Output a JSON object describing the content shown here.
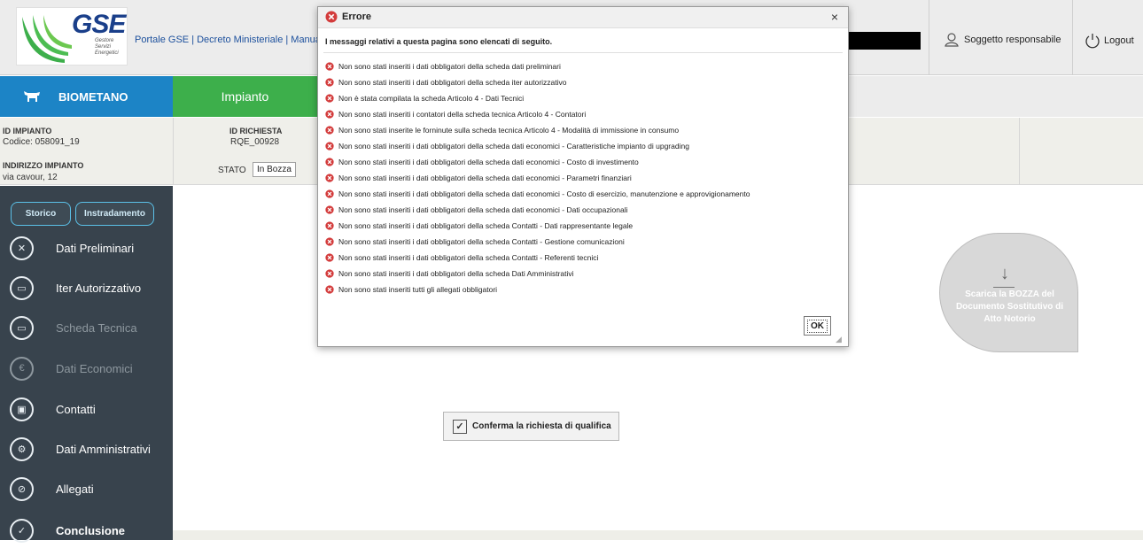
{
  "header": {
    "logo_text": "GSE",
    "logo_subtitle": "Gestore Servizi Energetici",
    "links": "Portale GSE | Decreto Ministeriale | Manuale",
    "user_label": "Soggetto responsabile",
    "logout_label": "Logout"
  },
  "nav": {
    "biometano": "BIOMETANO",
    "impianto": "Impianto"
  },
  "info": {
    "id_impianto_label": "ID IMPIANTO",
    "codice": "Codice: 058091_19",
    "indirizzo_label": "INDIRIZZO IMPIANTO",
    "indirizzo": "via cavour, 12",
    "id_richiesta_label": "ID RICHIESTA",
    "id_richiesta": "RQE_00928",
    "stato_label": "STATO",
    "stato": "In Bozza"
  },
  "sidebar": {
    "storico": "Storico",
    "instradamento": "Instradamento",
    "items": [
      {
        "label": "Dati Preliminari",
        "icon": "x-icon"
      },
      {
        "label": "Iter Autorizzativo",
        "icon": "calendar-icon"
      },
      {
        "label": "Scheda Tecnica",
        "icon": "wallet-icon"
      },
      {
        "label": "Dati Economici",
        "icon": "euro-icon"
      },
      {
        "label": "Contatti",
        "icon": "contacts-icon"
      },
      {
        "label": "Dati Amministrativi",
        "icon": "gear-icon"
      },
      {
        "label": "Allegati",
        "icon": "paperclip-icon"
      },
      {
        "label": "Conclusione",
        "icon": "check-icon"
      }
    ]
  },
  "main": {
    "confirm_button": "Conferma la richiesta di qualifica",
    "download_text": "Scarica la BOZZA del Documento Sostitutivo di Atto Notorio"
  },
  "dialog": {
    "title": "Errore",
    "close": "×",
    "intro": "I messaggi relativi a questa pagina sono elencati di seguito.",
    "messages": [
      "Non sono stati inseriti i dati obbligatori della scheda dati preliminari",
      "Non sono stati inseriti i dati obbligatori della scheda iter autorizzativo",
      "Non è stata compilata la scheda Articolo 4 - Dati Tecnici",
      "Non sono stati inseriti i contatori della scheda tecnica Articolo 4 - Contatori",
      "Non sono stati inserite le forninute sulla scheda tecnica Articolo 4 - Modalità di immissione in consumo",
      "Non sono stati inseriti i dati obbligatori della scheda dati economici - Caratteristiche impianto di upgrading",
      "Non sono stati inseriti i dati obbligatori della scheda dati economici - Costo di investimento",
      "Non sono stati inseriti i dati obbligatori della scheda dati economici - Parametri finanziari",
      "Non sono stati inseriti i dati obbligatori della scheda dati economici - Costo di esercizio, manutenzione e approvigionamento",
      "Non sono stati inseriti i dati obbligatori della scheda dati economici - Dati occupazionali",
      "Non sono stati inseriti i dati obbligatori della scheda Contatti - Dati rappresentante legale",
      "Non sono stati inseriti i dati obbligatori della scheda Contatti - Gestione comunicazioni",
      "Non sono stati inseriti i dati obbligatori della scheda Contatti - Referenti tecnici",
      "Non sono stati inseriti i dati obbligatori della scheda Dati Amministrativi",
      "Non sono stati inseriti tutti gli allegati obbligatori"
    ],
    "ok": "OK"
  },
  "colors": {
    "biometano": "#1c84c6",
    "impianto": "#3daf4b",
    "sidebar": "#38434d",
    "error": "#d33b3b"
  }
}
